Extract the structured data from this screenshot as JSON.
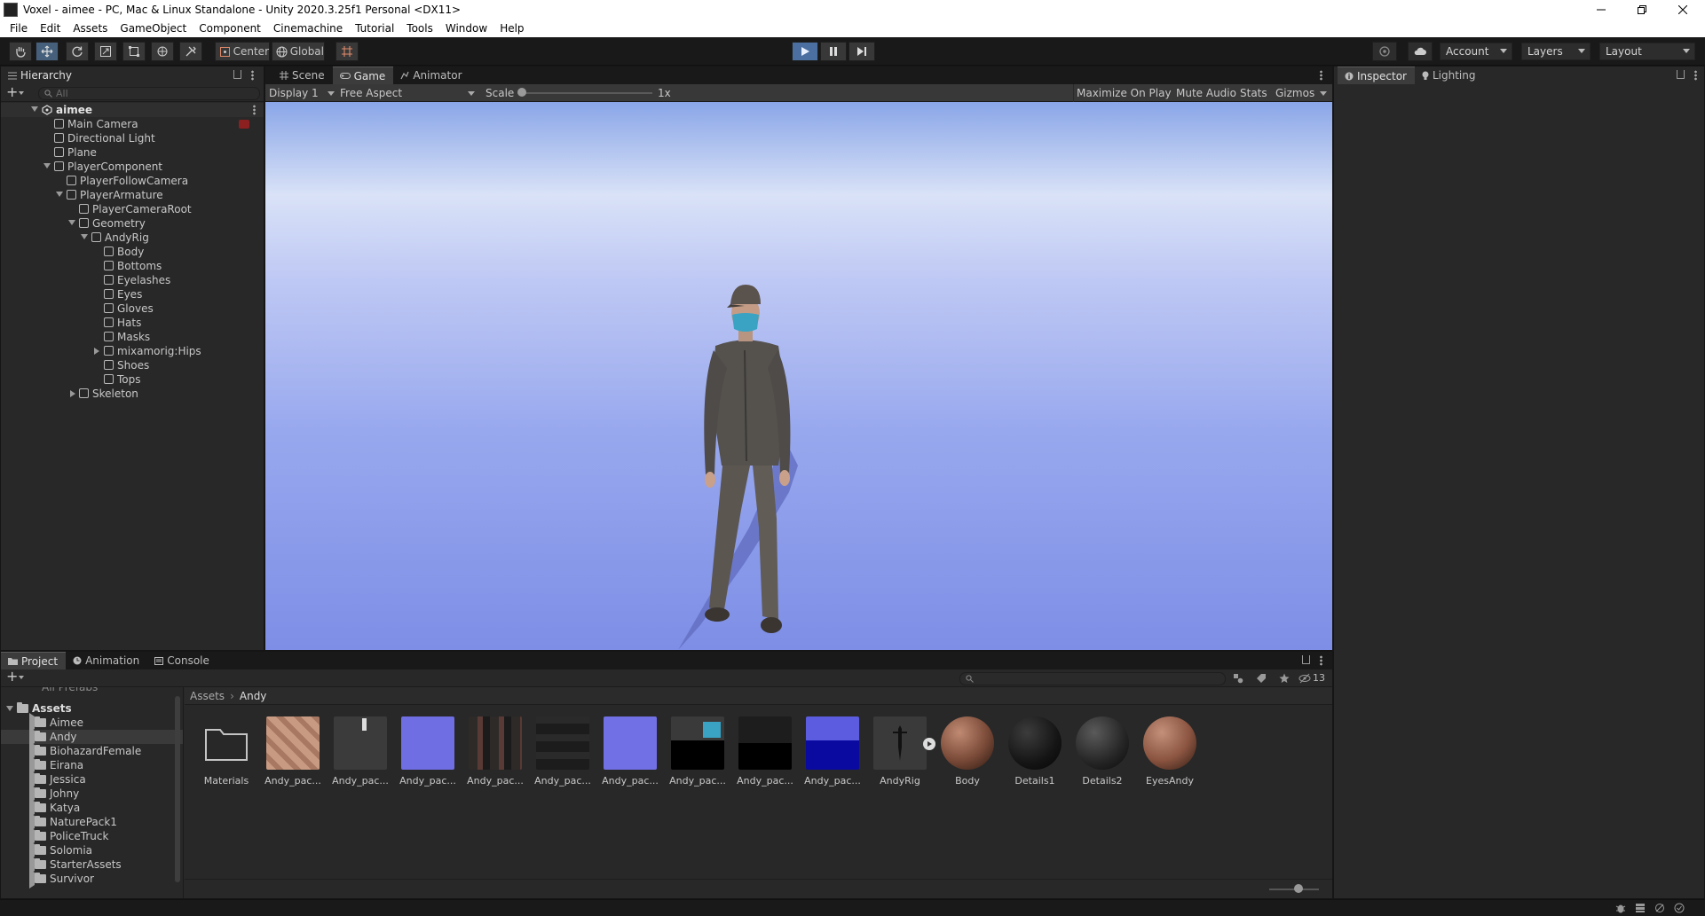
{
  "window": {
    "title": "Voxel - aimee - PC, Mac & Linux Standalone - Unity 2020.3.25f1 Personal <DX11>"
  },
  "menu": [
    "File",
    "Edit",
    "Assets",
    "GameObject",
    "Component",
    "Cinemachine",
    "Tutorial",
    "Tools",
    "Window",
    "Help"
  ],
  "toolbar": {
    "pivot_label": "Center",
    "space_label": "Global",
    "account_label": "Account",
    "layers_label": "Layers",
    "layout_label": "Layout"
  },
  "hierarchy": {
    "tab": "Hierarchy",
    "search_placeholder": "All",
    "scene": "aimee",
    "items": [
      {
        "label": "Main Camera"
      },
      {
        "label": "Directional Light"
      },
      {
        "label": "Plane"
      },
      {
        "label": "PlayerComponent"
      },
      {
        "label": "PlayerFollowCamera"
      },
      {
        "label": "PlayerArmature"
      },
      {
        "label": "PlayerCameraRoot"
      },
      {
        "label": "Geometry"
      },
      {
        "label": "AndyRig"
      },
      {
        "label": "Body"
      },
      {
        "label": "Bottoms"
      },
      {
        "label": "Eyelashes"
      },
      {
        "label": "Eyes"
      },
      {
        "label": "Gloves"
      },
      {
        "label": "Hats"
      },
      {
        "label": "Masks"
      },
      {
        "label": "mixamorig:Hips"
      },
      {
        "label": "Shoes"
      },
      {
        "label": "Tops"
      },
      {
        "label": "Skeleton"
      }
    ]
  },
  "center_tabs": [
    "Scene",
    "Game",
    "Animator"
  ],
  "game_view": {
    "display": "Display 1",
    "aspect": "Free Aspect",
    "scale_label": "Scale",
    "scale_value": "1x",
    "maximize": "Maximize On Play",
    "mute": "Mute Audio",
    "stats": "Stats",
    "gizmos": "Gizmos"
  },
  "right_tabs": [
    "Inspector",
    "Lighting"
  ],
  "bottom_tabs": [
    "Project",
    "Animation",
    "Console"
  ],
  "project": {
    "clipped_row": "All Prefabs",
    "root": "Assets",
    "folders": [
      "Aimee",
      "Andy",
      "BiohazardFemale",
      "Eirana",
      "Jessica",
      "Johny",
      "Katya",
      "NaturePack1",
      "PoliceTruck",
      "Solomia",
      "StarterAssets",
      "Survivor"
    ],
    "selected_folder": "Andy",
    "breadcrumb": [
      "Assets",
      "Andy"
    ],
    "hidden_count": "13",
    "assets": [
      {
        "label": "Materials",
        "kind": "folder"
      },
      {
        "label": "Andy_pac...",
        "kind": "skin-texture"
      },
      {
        "label": "Andy_pac...",
        "kind": "dark-texture"
      },
      {
        "label": "Andy_pac...",
        "kind": "normal-map"
      },
      {
        "label": "Andy_pac...",
        "kind": "atlas-texture"
      },
      {
        "label": "Andy_pac...",
        "kind": "dark-atlas"
      },
      {
        "label": "Andy_pac...",
        "kind": "normal-map"
      },
      {
        "label": "Andy_pac...",
        "kind": "mask-texture"
      },
      {
        "label": "Andy_pac...",
        "kind": "black-texture"
      },
      {
        "label": "Andy_pac...",
        "kind": "blue-texture"
      },
      {
        "label": "AndyRig",
        "kind": "model"
      },
      {
        "label": "Body",
        "kind": "material-brown"
      },
      {
        "label": "Details1",
        "kind": "material-black"
      },
      {
        "label": "Details2",
        "kind": "material-dark-grid"
      },
      {
        "label": "EyesAndy",
        "kind": "material-brown"
      }
    ]
  },
  "colors": {
    "accent_selection": "#46607c",
    "sky_top": "#c8d2f8",
    "sky_bottom": "#7a8ce8"
  }
}
